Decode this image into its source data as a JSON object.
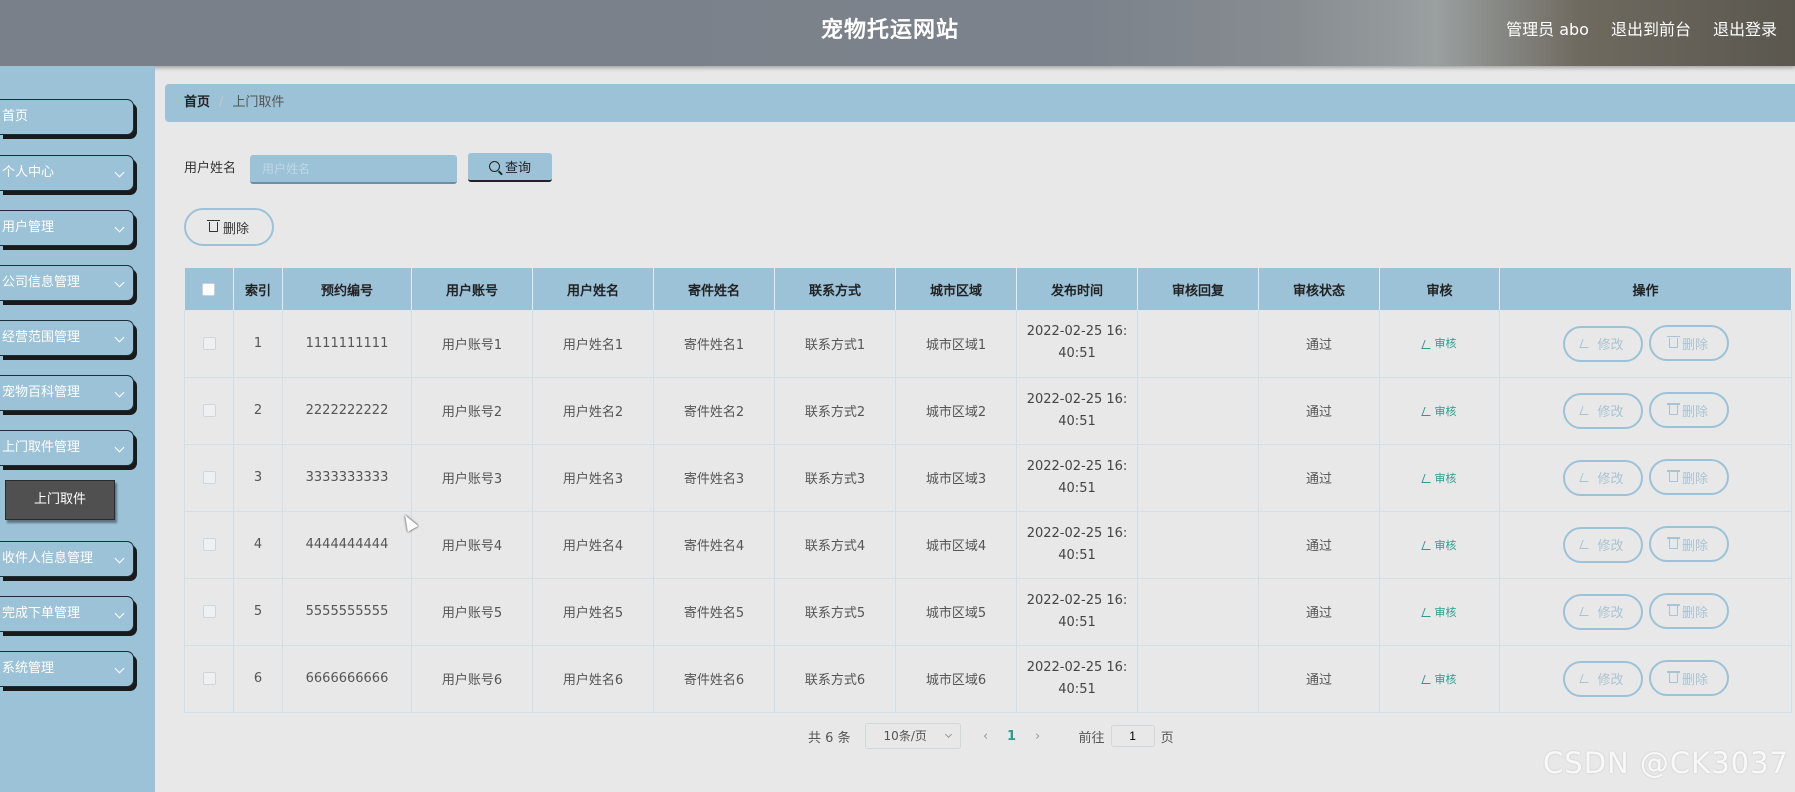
{
  "header": {
    "title": "宠物托运网站",
    "user": "管理员 abo",
    "to_front": "退出到前台",
    "logout": "退出登录"
  },
  "sidebar": {
    "items": [
      {
        "label": "首页",
        "has_arrow": false
      },
      {
        "label": "个人中心",
        "has_arrow": true
      },
      {
        "label": "用户管理",
        "has_arrow": true
      },
      {
        "label": "公司信息管理",
        "has_arrow": true
      },
      {
        "label": "经营范围管理",
        "has_arrow": true
      },
      {
        "label": "宠物百科管理",
        "has_arrow": true
      },
      {
        "label": "上门取件管理",
        "has_arrow": true
      },
      {
        "label": "收件人信息管理",
        "has_arrow": true
      },
      {
        "label": "完成下单管理",
        "has_arrow": true
      },
      {
        "label": "系统管理",
        "has_arrow": true
      }
    ],
    "active_sub": "上门取件"
  },
  "breadcrumb": {
    "home": "首页",
    "current": "上门取件"
  },
  "search": {
    "label": "用户姓名",
    "placeholder": "用户姓名",
    "button": "查询"
  },
  "toolbar": {
    "delete": "删除"
  },
  "table": {
    "columns": [
      "",
      "索引",
      "预约编号",
      "用户账号",
      "用户姓名",
      "寄件姓名",
      "联系方式",
      "城市区域",
      "发布时间",
      "审核回复",
      "审核状态",
      "审核",
      "操作"
    ],
    "rows": [
      {
        "index": "1",
        "code": "1111111111",
        "account": "用户账号1",
        "name": "用户姓名1",
        "sender": "寄件姓名1",
        "contact": "联系方式1",
        "area": "城市区域1",
        "time_a": "2022-02-25 16:",
        "time_b": "40:51",
        "reply": "",
        "status": "通过"
      },
      {
        "index": "2",
        "code": "2222222222",
        "account": "用户账号2",
        "name": "用户姓名2",
        "sender": "寄件姓名2",
        "contact": "联系方式2",
        "area": "城市区域2",
        "time_a": "2022-02-25 16:",
        "time_b": "40:51",
        "reply": "",
        "status": "通过"
      },
      {
        "index": "3",
        "code": "3333333333",
        "account": "用户账号3",
        "name": "用户姓名3",
        "sender": "寄件姓名3",
        "contact": "联系方式3",
        "area": "城市区域3",
        "time_a": "2022-02-25 16:",
        "time_b": "40:51",
        "reply": "",
        "status": "通过"
      },
      {
        "index": "4",
        "code": "4444444444",
        "account": "用户账号4",
        "name": "用户姓名4",
        "sender": "寄件姓名4",
        "contact": "联系方式4",
        "area": "城市区域4",
        "time_a": "2022-02-25 16:",
        "time_b": "40:51",
        "reply": "",
        "status": "通过"
      },
      {
        "index": "5",
        "code": "5555555555",
        "account": "用户账号5",
        "name": "用户姓名5",
        "sender": "寄件姓名5",
        "contact": "联系方式5",
        "area": "城市区域5",
        "time_a": "2022-02-25 16:",
        "time_b": "40:51",
        "reply": "",
        "status": "通过"
      },
      {
        "index": "6",
        "code": "6666666666",
        "account": "用户账号6",
        "name": "用户姓名6",
        "sender": "寄件姓名6",
        "contact": "联系方式6",
        "area": "城市区域6",
        "time_a": "2022-02-25 16:",
        "time_b": "40:51",
        "reply": "",
        "status": "通过"
      }
    ],
    "audit_label": "审核",
    "edit_label": "修改",
    "delete_label": "删除"
  },
  "pagination": {
    "total": "共 6 条",
    "page_size": "10条/页",
    "current_page": "1",
    "goto_label": "前往",
    "goto_value": "1",
    "page_suffix": "页"
  },
  "watermark": "CSDN @CK3037",
  "colors": {
    "accent": "#9cc2d8",
    "link": "#2a9d8f",
    "header": "#7c828b"
  }
}
